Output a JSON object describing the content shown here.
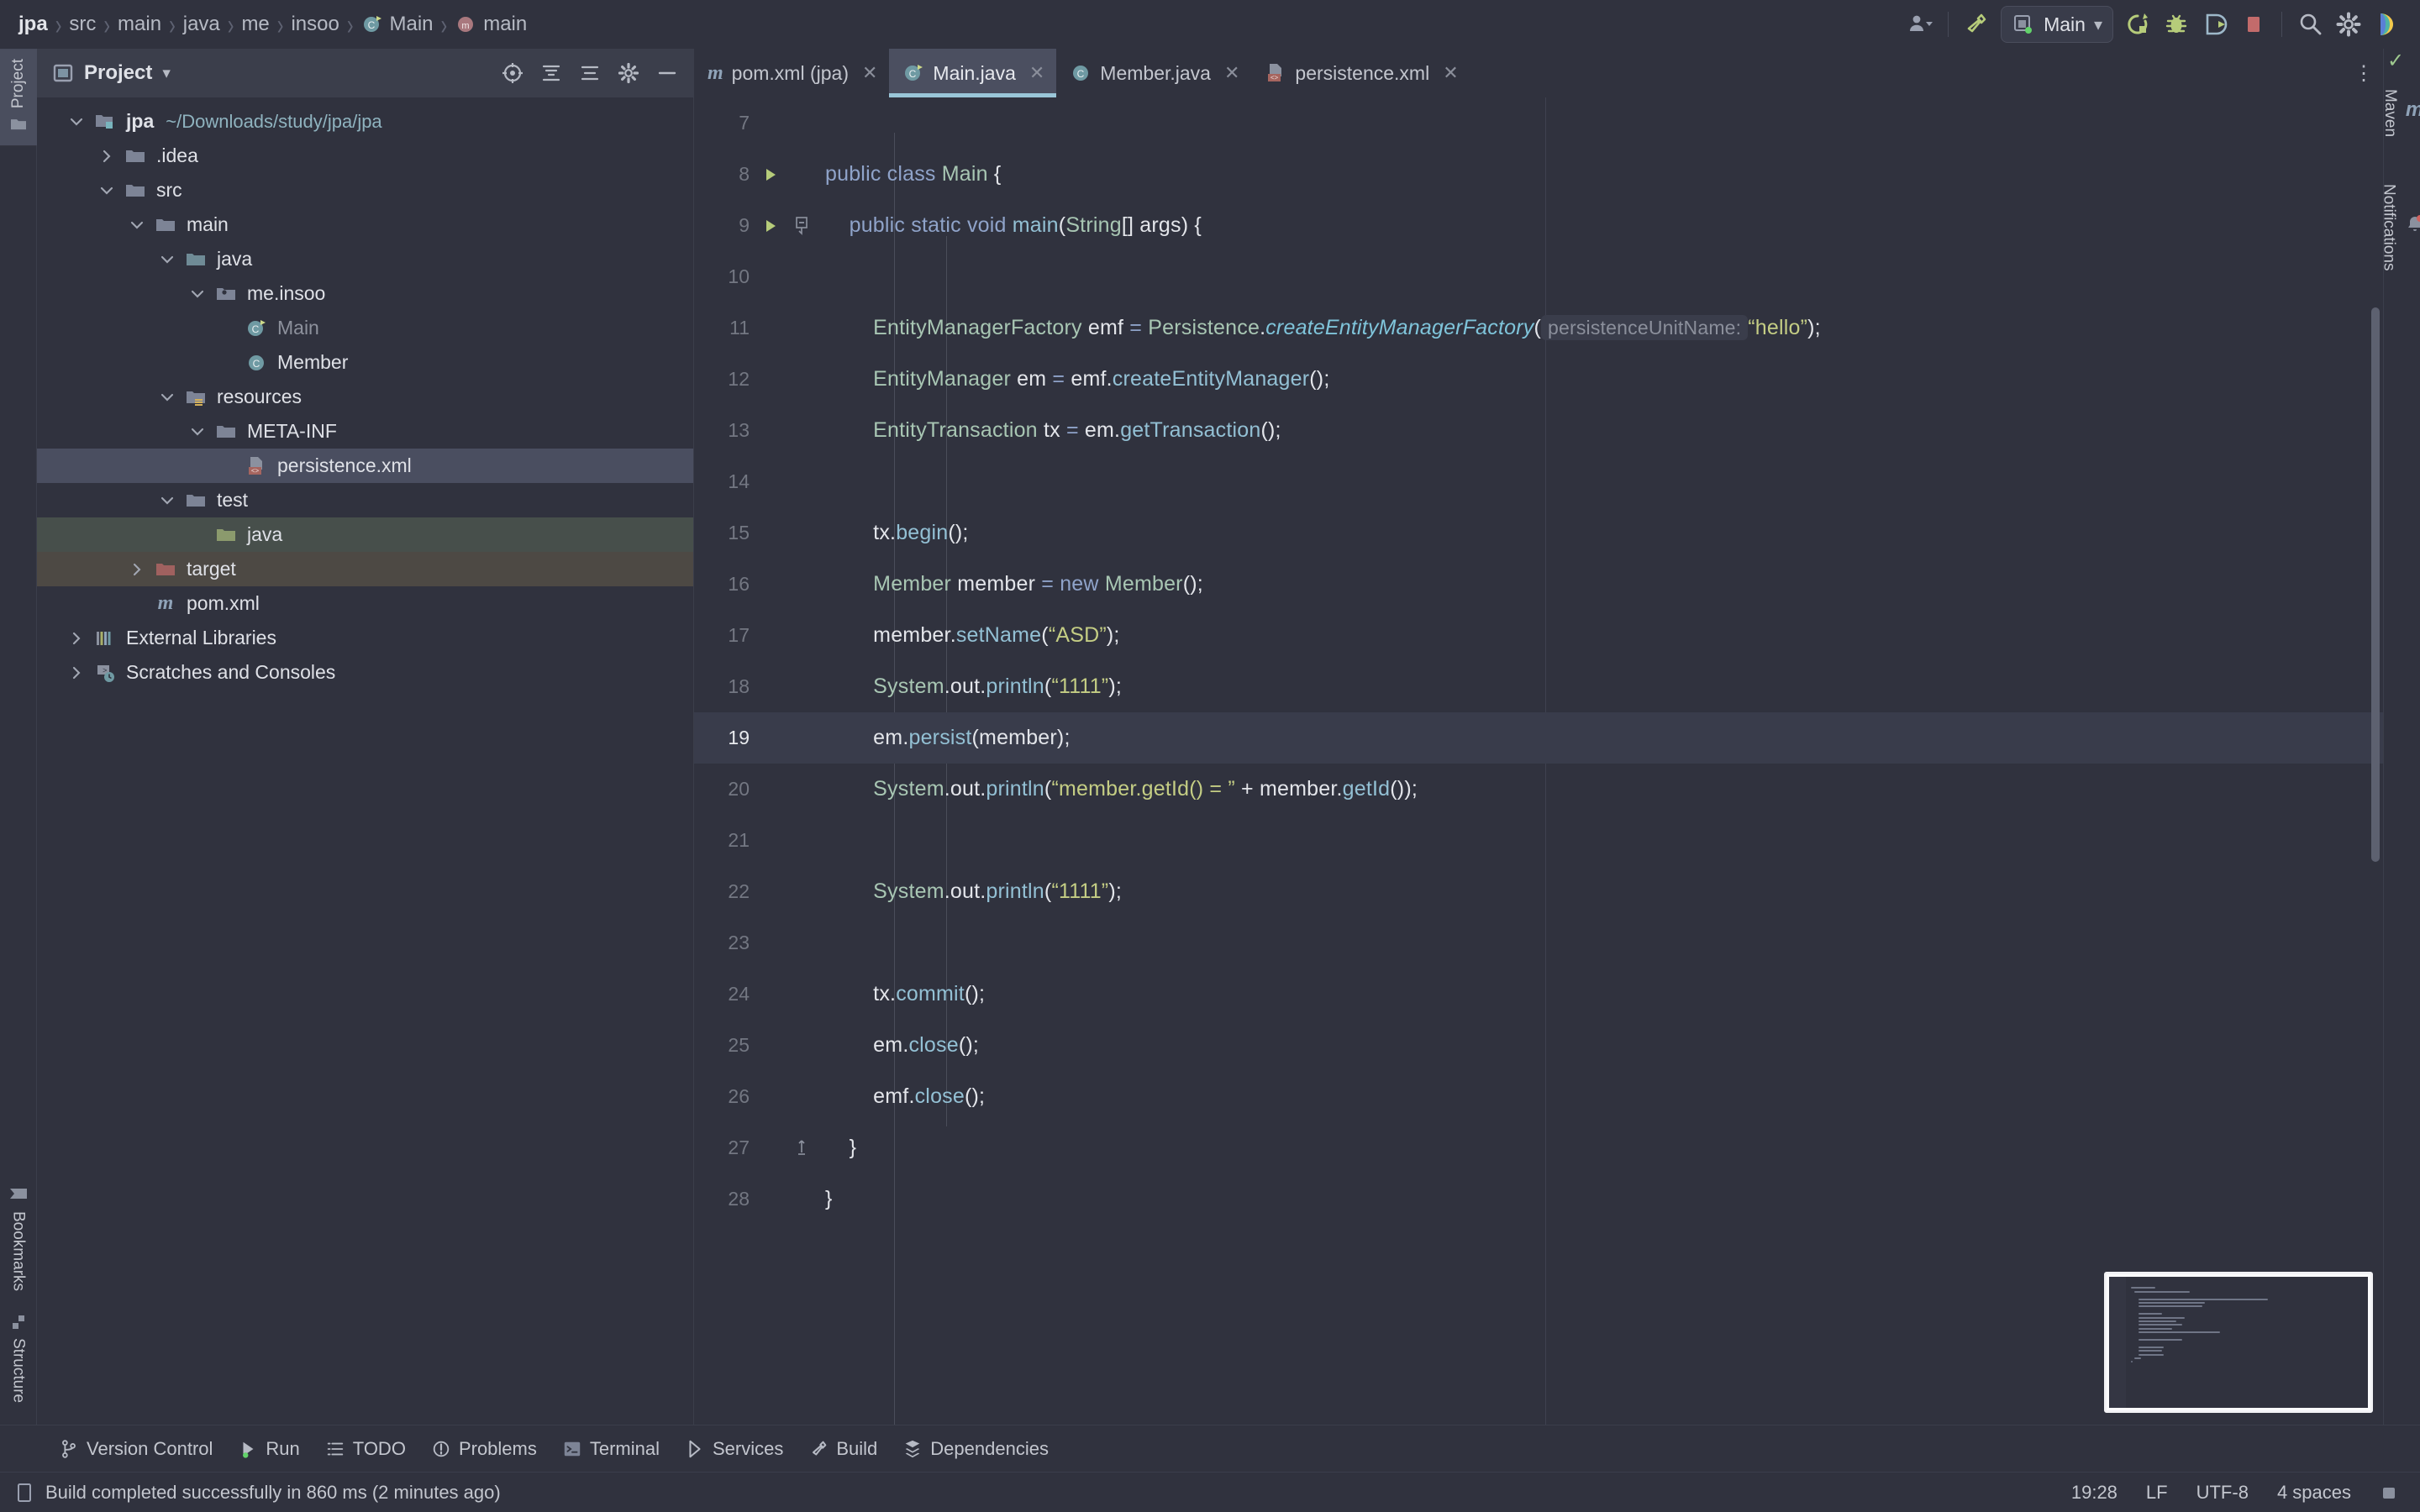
{
  "toolbar": {
    "breadcrumb": [
      {
        "label": "jpa",
        "icon": "none"
      },
      {
        "label": "src",
        "icon": "none"
      },
      {
        "label": "main",
        "icon": "none"
      },
      {
        "label": "java",
        "icon": "none"
      },
      {
        "label": "me",
        "icon": "none"
      },
      {
        "label": "insoo",
        "icon": "none"
      },
      {
        "label": "Main",
        "icon": "java-class-icon"
      },
      {
        "label": "main",
        "icon": "method-icon"
      }
    ],
    "separator": "›",
    "account_label": "account-icon",
    "build_label": "build-hammer-icon",
    "run_config": "Main",
    "run_config_caret": "▾",
    "run_label": "run-icon",
    "debug_label": "debug-icon",
    "coverage_label": "run-with-coverage-icon",
    "stop_label": "stop-icon",
    "search_label": "search-icon",
    "settings_label": "settings-icon",
    "logo_label": "intellij-logo-icon"
  },
  "left_rail": {
    "top": [
      {
        "label": "Project",
        "active": true
      }
    ],
    "bottom": [
      {
        "label": "Bookmarks",
        "active": false
      },
      {
        "label": "Structure",
        "active": false
      }
    ]
  },
  "right_rail": {
    "items": [
      {
        "label": "Maven",
        "icon": "maven-icon"
      },
      {
        "label": "Notifications",
        "icon": "bell-icon"
      }
    ]
  },
  "project_panel": {
    "title": "Project",
    "title_caret": "▾",
    "icons": [
      "select-opened-file-icon",
      "expand-all-icon",
      "collapse-all-icon",
      "settings-icon",
      "hide-icon"
    ],
    "tree": [
      {
        "depth": 0,
        "twisty": "down",
        "icon": "module-folder-icon",
        "label": "jpa",
        "path": "~/Downloads/study/jpa/jpa",
        "bold": true,
        "select": "none"
      },
      {
        "depth": 1,
        "twisty": "right",
        "icon": "folder-icon",
        "label": ".idea",
        "path": "",
        "bold": false,
        "select": "none"
      },
      {
        "depth": 1,
        "twisty": "down",
        "icon": "folder-icon",
        "label": "src",
        "path": "",
        "bold": false,
        "select": "none"
      },
      {
        "depth": 2,
        "twisty": "down",
        "icon": "folder-icon",
        "label": "main",
        "path": "",
        "bold": false,
        "select": "none"
      },
      {
        "depth": 3,
        "twisty": "down",
        "icon": "source-folder-icon",
        "label": "java",
        "path": "",
        "bold": false,
        "select": "none"
      },
      {
        "depth": 4,
        "twisty": "down",
        "icon": "package-icon",
        "label": "me.insoo",
        "path": "",
        "bold": false,
        "select": "none"
      },
      {
        "depth": 5,
        "twisty": "none",
        "icon": "runnable-class-icon",
        "label": "Main",
        "path": "",
        "bold": false,
        "select": "none",
        "dim": true
      },
      {
        "depth": 5,
        "twisty": "none",
        "icon": "class-icon",
        "label": "Member",
        "path": "",
        "bold": false,
        "select": "none"
      },
      {
        "depth": 3,
        "twisty": "down",
        "icon": "resource-folder-icon",
        "label": "resources",
        "path": "",
        "bold": false,
        "select": "none"
      },
      {
        "depth": 4,
        "twisty": "down",
        "icon": "folder-icon",
        "label": "META-INF",
        "path": "",
        "bold": false,
        "select": "none"
      },
      {
        "depth": 5,
        "twisty": "none",
        "icon": "xml-file-icon",
        "label": "persistence.xml",
        "path": "",
        "bold": false,
        "select": "blue"
      },
      {
        "depth": 3,
        "twisty": "down",
        "icon": "folder-icon",
        "label": "test",
        "path": "",
        "bold": false,
        "select": "none"
      },
      {
        "depth": 4,
        "twisty": "none",
        "icon": "test-folder-icon",
        "label": "java",
        "path": "",
        "bold": false,
        "select": "green"
      },
      {
        "depth": 2,
        "twisty": "right",
        "icon": "excluded-folder-icon",
        "label": "target",
        "path": "",
        "bold": false,
        "select": "brown"
      },
      {
        "depth": 2,
        "twisty": "none",
        "icon": "maven-icon",
        "label": "pom.xml",
        "path": "",
        "bold": false,
        "select": "none"
      },
      {
        "depth": 0,
        "twisty": "right",
        "icon": "libraries-icon",
        "label": "External Libraries",
        "path": "",
        "bold": false,
        "select": "none"
      },
      {
        "depth": 0,
        "twisty": "right",
        "icon": "scratches-icon",
        "label": "Scratches and Consoles",
        "path": "",
        "bold": false,
        "select": "none"
      }
    ]
  },
  "editor": {
    "tabs": [
      {
        "label": "pom.xml (jpa)",
        "icon": "maven-icon",
        "active": false,
        "close": "✕"
      },
      {
        "label": "Main.java",
        "icon": "runnable-class-icon",
        "active": true,
        "close": "✕"
      },
      {
        "label": "Member.java",
        "icon": "class-icon",
        "active": false,
        "close": "✕"
      },
      {
        "label": "persistence.xml",
        "icon": "xml-file-icon",
        "active": false,
        "close": "✕"
      }
    ],
    "tabs_more": "⋮",
    "inspection_status": "✓",
    "caret_line": 19,
    "lines": [
      {
        "num": 7,
        "run": false,
        "fold": "none",
        "tokens": []
      },
      {
        "num": 8,
        "run": true,
        "fold": "none",
        "tokens": [
          {
            "t": "public ",
            "c": "kw"
          },
          {
            "t": "class ",
            "c": "kw"
          },
          {
            "t": "Main",
            "c": "type"
          },
          {
            "t": " {",
            "c": "punc"
          }
        ]
      },
      {
        "num": 9,
        "run": true,
        "fold": "minus",
        "tokens": [
          {
            "t": "    ",
            "c": "plain"
          },
          {
            "t": "public ",
            "c": "kw"
          },
          {
            "t": "static ",
            "c": "kw"
          },
          {
            "t": "void ",
            "c": "kw"
          },
          {
            "t": "main",
            "c": "meth"
          },
          {
            "t": "(",
            "c": "punc"
          },
          {
            "t": "String",
            "c": "type"
          },
          {
            "t": "[] ",
            "c": "punc"
          },
          {
            "t": "args",
            "c": "plain"
          },
          {
            "t": ") {",
            "c": "punc"
          }
        ]
      },
      {
        "num": 10,
        "run": false,
        "fold": "none",
        "tokens": []
      },
      {
        "num": 11,
        "run": false,
        "fold": "none",
        "tokens": [
          {
            "t": "        ",
            "c": "plain"
          },
          {
            "t": "EntityManagerFactory",
            "c": "type"
          },
          {
            "t": " emf ",
            "c": "plain"
          },
          {
            "t": "= ",
            "c": "kw"
          },
          {
            "t": "Persistence",
            "c": "type"
          },
          {
            "t": ".",
            "c": "punc"
          },
          {
            "t": "createEntityManagerFactory",
            "c": "stat"
          },
          {
            "t": "(",
            "c": "punc"
          },
          {
            "t": "persistenceUnitName:",
            "c": "hint"
          },
          {
            "t": "“hello”",
            "c": "str"
          },
          {
            "t": ");",
            "c": "punc"
          }
        ]
      },
      {
        "num": 12,
        "run": false,
        "fold": "none",
        "tokens": [
          {
            "t": "        ",
            "c": "plain"
          },
          {
            "t": "EntityManager",
            "c": "type"
          },
          {
            "t": " em ",
            "c": "plain"
          },
          {
            "t": "= ",
            "c": "kw"
          },
          {
            "t": "emf",
            "c": "plain"
          },
          {
            "t": ".",
            "c": "punc"
          },
          {
            "t": "createEntityManager",
            "c": "meth"
          },
          {
            "t": "();",
            "c": "punc"
          }
        ]
      },
      {
        "num": 13,
        "run": false,
        "fold": "none",
        "tokens": [
          {
            "t": "        ",
            "c": "plain"
          },
          {
            "t": "EntityTransaction",
            "c": "type"
          },
          {
            "t": " tx ",
            "c": "plain"
          },
          {
            "t": "= ",
            "c": "kw"
          },
          {
            "t": "em",
            "c": "plain"
          },
          {
            "t": ".",
            "c": "punc"
          },
          {
            "t": "getTransaction",
            "c": "meth"
          },
          {
            "t": "();",
            "c": "punc"
          }
        ]
      },
      {
        "num": 14,
        "run": false,
        "fold": "none",
        "tokens": []
      },
      {
        "num": 15,
        "run": false,
        "fold": "none",
        "tokens": [
          {
            "t": "        ",
            "c": "plain"
          },
          {
            "t": "tx",
            "c": "plain"
          },
          {
            "t": ".",
            "c": "punc"
          },
          {
            "t": "begin",
            "c": "meth"
          },
          {
            "t": "();",
            "c": "punc"
          }
        ]
      },
      {
        "num": 16,
        "run": false,
        "fold": "none",
        "tokens": [
          {
            "t": "        ",
            "c": "plain"
          },
          {
            "t": "Member",
            "c": "type"
          },
          {
            "t": " member ",
            "c": "plain"
          },
          {
            "t": "= ",
            "c": "kw"
          },
          {
            "t": "new ",
            "c": "kw"
          },
          {
            "t": "Member",
            "c": "type"
          },
          {
            "t": "();",
            "c": "punc"
          }
        ]
      },
      {
        "num": 17,
        "run": false,
        "fold": "none",
        "tokens": [
          {
            "t": "        ",
            "c": "plain"
          },
          {
            "t": "member",
            "c": "plain"
          },
          {
            "t": ".",
            "c": "punc"
          },
          {
            "t": "setName",
            "c": "meth"
          },
          {
            "t": "(",
            "c": "punc"
          },
          {
            "t": "“ASD”",
            "c": "str"
          },
          {
            "t": ");",
            "c": "punc"
          }
        ]
      },
      {
        "num": 18,
        "run": false,
        "fold": "none",
        "tokens": [
          {
            "t": "        ",
            "c": "plain"
          },
          {
            "t": "System",
            "c": "type"
          },
          {
            "t": ".",
            "c": "punc"
          },
          {
            "t": "out",
            "c": "plain"
          },
          {
            "t": ".",
            "c": "punc"
          },
          {
            "t": "println",
            "c": "meth"
          },
          {
            "t": "(",
            "c": "punc"
          },
          {
            "t": "“1111”",
            "c": "str"
          },
          {
            "t": ");",
            "c": "punc"
          }
        ]
      },
      {
        "num": 19,
        "run": false,
        "fold": "none",
        "tokens": [
          {
            "t": "        ",
            "c": "plain"
          },
          {
            "t": "em",
            "c": "plain"
          },
          {
            "t": ".",
            "c": "punc"
          },
          {
            "t": "persist",
            "c": "meth"
          },
          {
            "t": "(member);",
            "c": "punc"
          }
        ]
      },
      {
        "num": 20,
        "run": false,
        "fold": "none",
        "tokens": [
          {
            "t": "        ",
            "c": "plain"
          },
          {
            "t": "System",
            "c": "type"
          },
          {
            "t": ".",
            "c": "punc"
          },
          {
            "t": "out",
            "c": "plain"
          },
          {
            "t": ".",
            "c": "punc"
          },
          {
            "t": "println",
            "c": "meth"
          },
          {
            "t": "(",
            "c": "punc"
          },
          {
            "t": "“member.getId() = ”",
            "c": "str"
          },
          {
            "t": " + ",
            "c": "punc"
          },
          {
            "t": "member",
            "c": "plain"
          },
          {
            "t": ".",
            "c": "punc"
          },
          {
            "t": "getId",
            "c": "meth"
          },
          {
            "t": "());",
            "c": "punc"
          }
        ]
      },
      {
        "num": 21,
        "run": false,
        "fold": "none",
        "tokens": []
      },
      {
        "num": 22,
        "run": false,
        "fold": "none",
        "tokens": [
          {
            "t": "        ",
            "c": "plain"
          },
          {
            "t": "System",
            "c": "type"
          },
          {
            "t": ".",
            "c": "punc"
          },
          {
            "t": "out",
            "c": "plain"
          },
          {
            "t": ".",
            "c": "punc"
          },
          {
            "t": "println",
            "c": "meth"
          },
          {
            "t": "(",
            "c": "punc"
          },
          {
            "t": "“1111”",
            "c": "str"
          },
          {
            "t": ");",
            "c": "punc"
          }
        ]
      },
      {
        "num": 23,
        "run": false,
        "fold": "none",
        "tokens": []
      },
      {
        "num": 24,
        "run": false,
        "fold": "none",
        "tokens": [
          {
            "t": "        ",
            "c": "plain"
          },
          {
            "t": "tx",
            "c": "plain"
          },
          {
            "t": ".",
            "c": "punc"
          },
          {
            "t": "commit",
            "c": "meth"
          },
          {
            "t": "();",
            "c": "punc"
          }
        ]
      },
      {
        "num": 25,
        "run": false,
        "fold": "none",
        "tokens": [
          {
            "t": "        ",
            "c": "plain"
          },
          {
            "t": "em",
            "c": "plain"
          },
          {
            "t": ".",
            "c": "punc"
          },
          {
            "t": "close",
            "c": "meth"
          },
          {
            "t": "();",
            "c": "punc"
          }
        ]
      },
      {
        "num": 26,
        "run": false,
        "fold": "none",
        "tokens": [
          {
            "t": "        ",
            "c": "plain"
          },
          {
            "t": "emf",
            "c": "plain"
          },
          {
            "t": ".",
            "c": "punc"
          },
          {
            "t": "close",
            "c": "meth"
          },
          {
            "t": "();",
            "c": "punc"
          }
        ]
      },
      {
        "num": 27,
        "run": false,
        "fold": "end",
        "tokens": [
          {
            "t": "    }",
            "c": "punc"
          }
        ]
      },
      {
        "num": 28,
        "run": false,
        "fold": "none",
        "tokens": [
          {
            "t": "}",
            "c": "punc"
          }
        ]
      }
    ]
  },
  "bottom_bar": {
    "items": [
      {
        "label": "Version Control",
        "icon": "branch-icon"
      },
      {
        "label": "Run",
        "icon": "run-icon"
      },
      {
        "label": "TODO",
        "icon": "todo-icon"
      },
      {
        "label": "Problems",
        "icon": "problems-icon"
      },
      {
        "label": "Terminal",
        "icon": "terminal-icon"
      },
      {
        "label": "Services",
        "icon": "services-icon"
      },
      {
        "label": "Build",
        "icon": "build-hammer-icon"
      },
      {
        "label": "Dependencies",
        "icon": "dependencies-icon"
      }
    ]
  },
  "status_bar": {
    "message_icon": "build-status-icon",
    "message": "Build completed successfully in 860 ms (2 minutes ago)",
    "time": "19:28",
    "line_separator": "LF",
    "encoding": "UTF-8",
    "indent": "4 spaces",
    "lock_icon": "read-only-icon"
  },
  "colors": {
    "background": "#30323e",
    "panel_header": "#3b3e4b",
    "tab_active": "#4b4f60",
    "tab_underline": "#9ac6d8",
    "caret_line": "#393c4b",
    "keyword": "#8fa3c9",
    "type": "#a8c6b3",
    "method": "#93c0d4",
    "static_method": "#7fc4da",
    "string": "#c4cd84",
    "stop_red": "#c36b6b",
    "run_green": "#b6cc7a",
    "notification_dot": "#d1625f"
  }
}
